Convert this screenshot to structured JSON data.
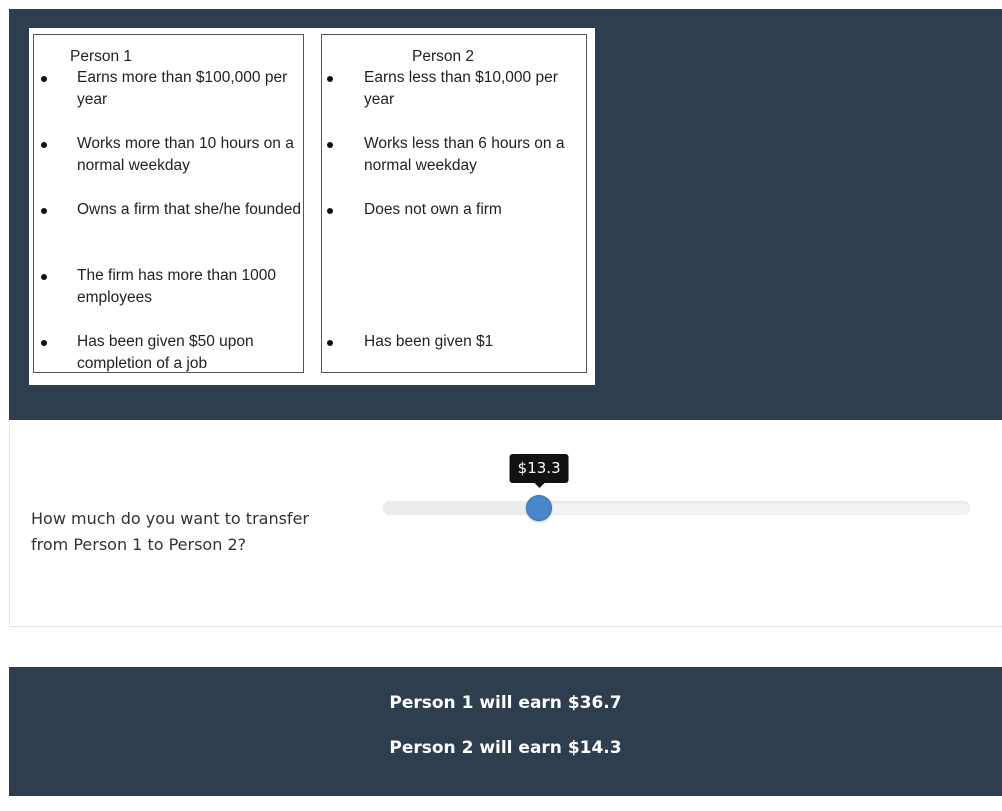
{
  "comparison": {
    "person1": {
      "title": "Person 1",
      "bullets": [
        "Earns more than $100,000 per year",
        "Works more than 10 hours on a normal weekday",
        "Owns a firm that she/he founded",
        "The firm has more than 1000 employees",
        "Has been given $50 upon completion of a job"
      ]
    },
    "person2": {
      "title": "Person 2",
      "bullets": [
        "Earns less than $10,000 per year",
        "Works less than 6 hours on a normal weekday",
        "Does not own a firm",
        "Has been given $1"
      ]
    }
  },
  "question": {
    "text": "How much do you want to trans­fer from Person 1 to Person 2?"
  },
  "slider": {
    "tooltip": "$13.3",
    "value": 13.3,
    "min": 0,
    "max": 50
  },
  "results": {
    "person1": "Person 1 will earn $36.7",
    "person2": "Person 2 will earn $14.3"
  },
  "colors": {
    "panel": "#2f3e4f",
    "thumb": "#4a87c9"
  }
}
